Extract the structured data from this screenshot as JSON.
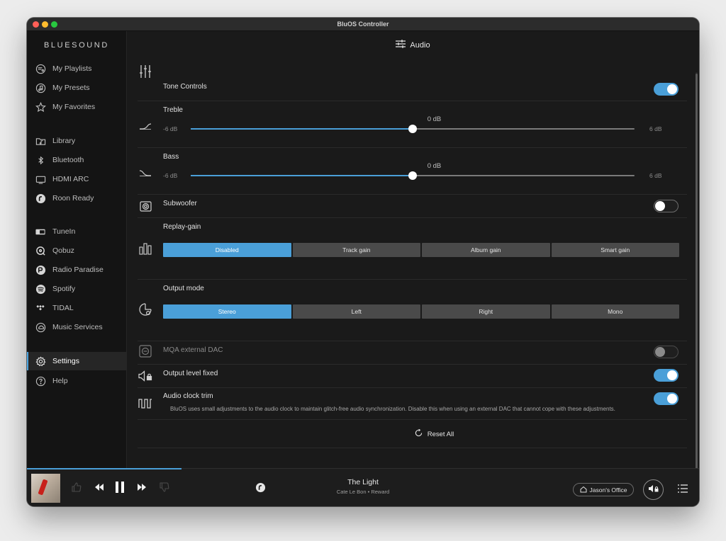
{
  "window": {
    "title": "BluOS Controller"
  },
  "sidebar": {
    "logo": "BLUESOUND",
    "items": [
      {
        "label": "My Playlists",
        "icon": "playlist-icon"
      },
      {
        "label": "My Presets",
        "icon": "music-note-icon"
      },
      {
        "label": "My Favorites",
        "icon": "star-icon"
      },
      {
        "label": "Library",
        "icon": "folder-music-icon"
      },
      {
        "label": "Bluetooth",
        "icon": "bluetooth-icon"
      },
      {
        "label": "HDMI ARC",
        "icon": "tv-icon"
      },
      {
        "label": "Roon Ready",
        "icon": "roon-icon"
      },
      {
        "label": "TuneIn",
        "icon": "tunein-icon"
      },
      {
        "label": "Qobuz",
        "icon": "qobuz-icon"
      },
      {
        "label": "Radio Paradise",
        "icon": "radio-paradise-icon"
      },
      {
        "label": "Spotify",
        "icon": "spotify-icon"
      },
      {
        "label": "TIDAL",
        "icon": "tidal-icon"
      },
      {
        "label": "Music Services",
        "icon": "cloud-icon"
      },
      {
        "label": "Settings",
        "icon": "gear-icon",
        "active": true
      },
      {
        "label": "Help",
        "icon": "help-icon"
      }
    ]
  },
  "main": {
    "title": "Audio",
    "tone_controls": {
      "label": "Tone Controls",
      "enabled": true
    },
    "treble": {
      "label": "Treble",
      "min_label": "-6 dB",
      "max_label": "6 dB",
      "value_label": "0 dB",
      "value": 0,
      "min": -6,
      "max": 6
    },
    "bass": {
      "label": "Bass",
      "min_label": "-6 dB",
      "max_label": "6 dB",
      "value_label": "0 dB",
      "value": 0,
      "min": -6,
      "max": 6
    },
    "subwoofer": {
      "label": "Subwoofer",
      "enabled": false
    },
    "replay_gain": {
      "label": "Replay-gain",
      "options": [
        "Disabled",
        "Track gain",
        "Album gain",
        "Smart gain"
      ],
      "selected": "Disabled"
    },
    "output_mode": {
      "label": "Output mode",
      "options": [
        "Stereo",
        "Left",
        "Right",
        "Mono"
      ],
      "selected": "Stereo"
    },
    "mqa": {
      "label": "MQA external DAC",
      "enabled": false,
      "disabled": true
    },
    "output_level_fixed": {
      "label": "Output level fixed",
      "enabled": true
    },
    "audio_clock_trim": {
      "label": "Audio clock trim",
      "enabled": true,
      "description": "BluOS uses small adjustments to the audio clock to maintain glitch-free audio synchronization. Disable this when using an external DAC that cannot cope with these adjustments."
    },
    "reset_all": "Reset All"
  },
  "player": {
    "title": "The Light",
    "subtitle": "Cate Le Bon • Reward",
    "room": "Jason's Office",
    "progress": 0.23,
    "accent": "#4a9fd8"
  }
}
